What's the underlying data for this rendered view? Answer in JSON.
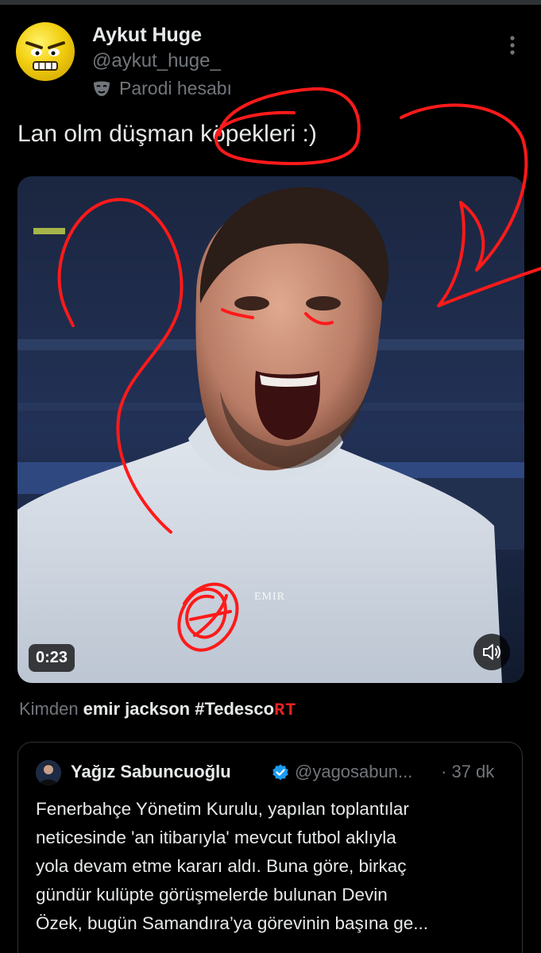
{
  "post": {
    "author": {
      "name": "Aykut Huge",
      "handle": "@aykut_huge_",
      "badge_label": "Parodi hesabı"
    },
    "text": "Lan olm düşman köpekleri :)",
    "media": {
      "duration": "0:23",
      "shirt_logo": "EMIR"
    },
    "source": {
      "prefix": "Kimden",
      "name": "emir jackson #Tedesco",
      "annotation": "RT"
    }
  },
  "quote": {
    "name": "Yağız Sabuncuoğlu",
    "handle": "@yagosabun...",
    "time": "· 37 dk",
    "lines": [
      "Fenerbahçe Yönetim Kurulu, yapılan toplantılar",
      "neticesinde 'an itibarıyla' mevcut futbol aklıyla",
      "yola devam etme kararı aldı. Buna göre, birkaç",
      "gündür kulüpte görüşmelerde bulunan Devin",
      "Özek, bugün Samandıra’ya görevinin başına ge..."
    ]
  },
  "colors": {
    "background": "#000000",
    "text": "#e7e9ea",
    "secondary": "#71767b",
    "verified": "#1d9bf0",
    "scribble": "#ff1a1a"
  },
  "icons": [
    "mask-icon",
    "more-icon",
    "volume-icon",
    "verified-icon"
  ]
}
